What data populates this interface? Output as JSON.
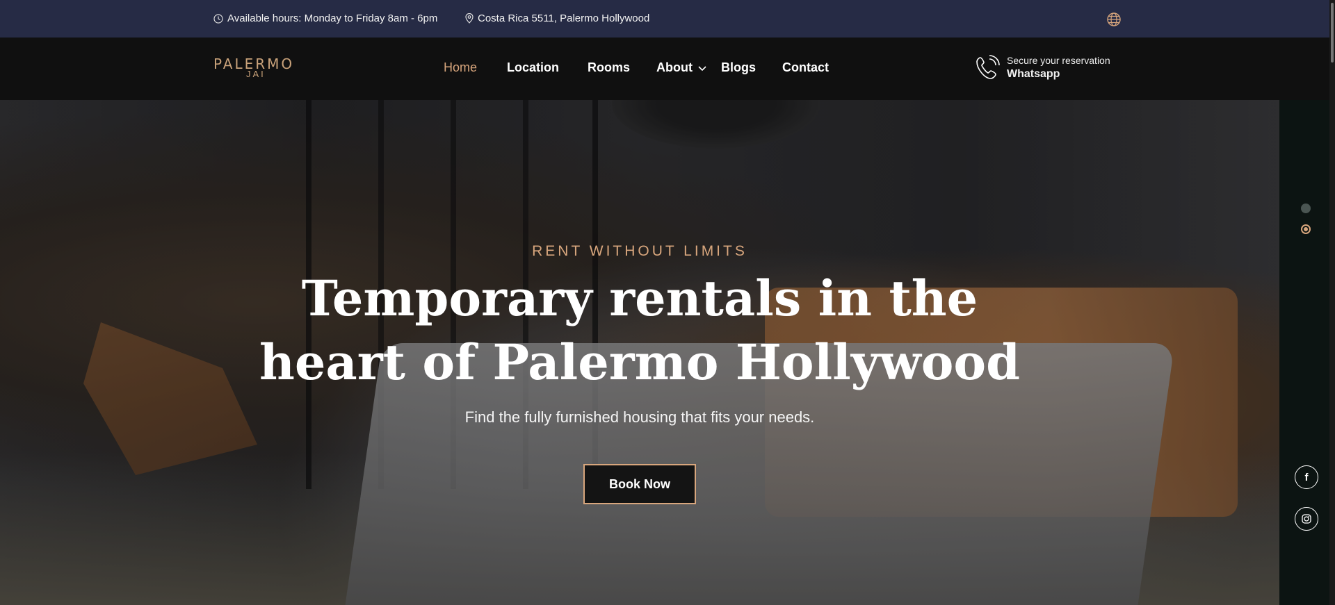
{
  "topbar": {
    "hours": "Available hours: Monday to Friday 8am - 6pm",
    "address": "Costa Rica 5511, Palermo Hollywood",
    "globe_icon": "globe-icon"
  },
  "brand": {
    "logo_line1": "PALERMO",
    "logo_line2": "JAI",
    "accent": "#d8a67d"
  },
  "nav": {
    "items": [
      {
        "label": "Home",
        "active": true
      },
      {
        "label": "Location",
        "active": false
      },
      {
        "label": "Rooms",
        "active": false
      },
      {
        "label": "About",
        "active": false,
        "dropdown": true
      },
      {
        "label": "Blogs",
        "active": false
      },
      {
        "label": "Contact",
        "active": false
      }
    ]
  },
  "reservation": {
    "line1": "Secure your reservation",
    "line2": "Whatsapp",
    "icon": "phone-icon"
  },
  "hero": {
    "eyebrow": "RENT WITHOUT LIMITS",
    "headline_line1": "Temporary rentals in the",
    "headline_line2": "heart of Palermo Hollywood",
    "subtitle": "Find the fully furnished housing that fits your needs.",
    "cta": "Book Now"
  },
  "social": {
    "facebook": "f",
    "instagram_icon": "instagram-icon"
  }
}
